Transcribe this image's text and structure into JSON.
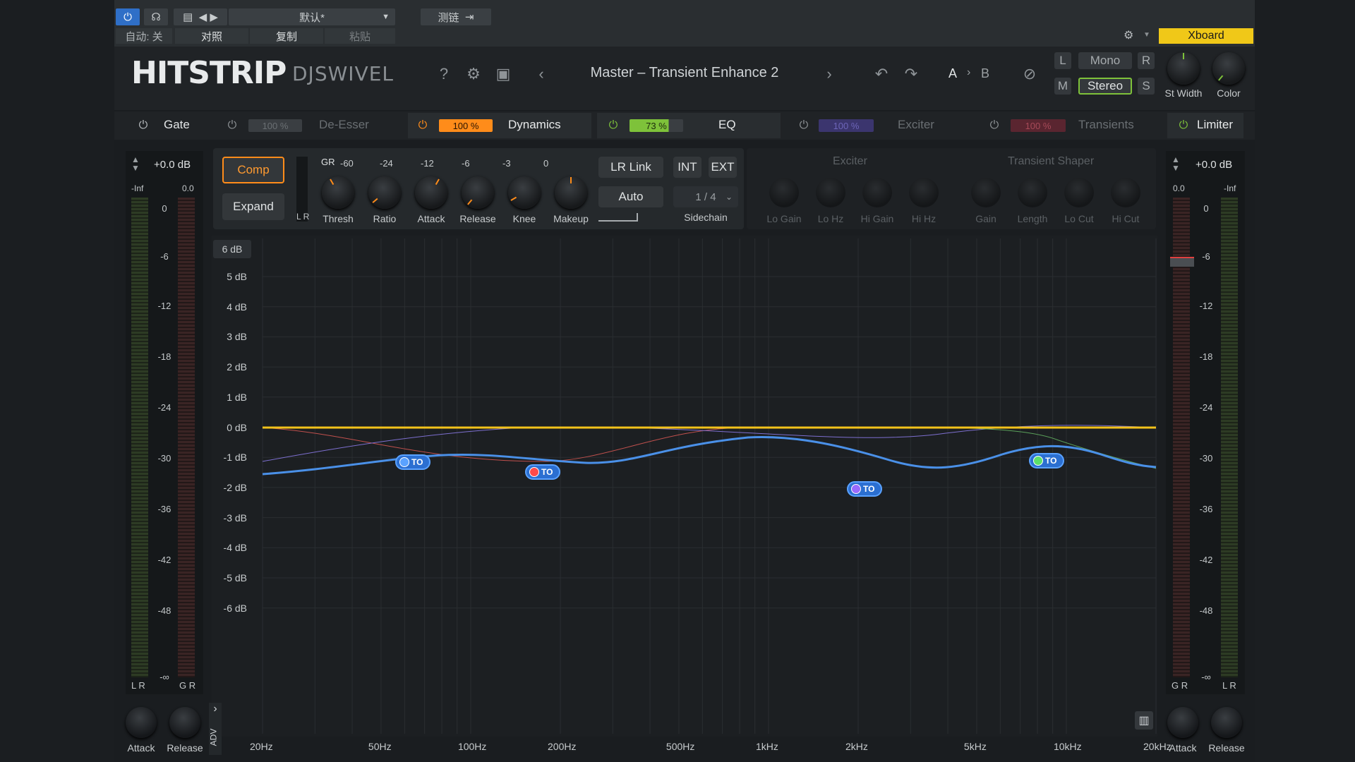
{
  "host": {
    "preset_name": "默认*",
    "auto_label": "自动: 关",
    "compare_label": "对照",
    "copy_label": "复制",
    "paste_label": "粘贴",
    "sidechain_label": "测链",
    "xboard_label": "Xboard"
  },
  "header": {
    "logo": "HITSTRIP",
    "brand": "DJSWIVEL",
    "preset_title": "Master – Transient Enhance 2",
    "ab_a": "A",
    "ab_b": "B",
    "l_label": "L",
    "r_label": "R",
    "m_label": "M",
    "s_label": "S",
    "mono_label": "Mono",
    "stereo_label": "Stereo",
    "stwidth_label": "St Width",
    "color_label": "Color"
  },
  "modules": [
    {
      "name": "Gate",
      "percent": "",
      "color": "#cfd3d6"
    },
    {
      "name": "De-Esser",
      "percent": "100 %",
      "color": "#6a6f73"
    },
    {
      "name": "Dynamics",
      "percent": "100 %",
      "color": "#ff8c1a"
    },
    {
      "name": "EQ",
      "percent": "73 %",
      "color": "#7ec23a"
    },
    {
      "name": "Exciter",
      "percent": "100 %",
      "color": "#5a4fb8"
    },
    {
      "name": "Transients",
      "percent": "100 %",
      "color": "#b83a4a"
    },
    {
      "name": "Limiter",
      "percent": "",
      "color": "#cfd3d6"
    }
  ],
  "input_meter": {
    "gain": "+0.0 dB",
    "min_label": "-Inf",
    "max_label": "0.0",
    "scale": [
      "0",
      "-6",
      "-12",
      "-18",
      "-24",
      "-30",
      "-36",
      "-42",
      "-48",
      "-∞"
    ],
    "lr_label": "L R",
    "gr_label": "G R"
  },
  "output_meter": {
    "gain": "+0.0 dB",
    "min_label": "0.0",
    "max_label": "-Inf",
    "scale": [
      "0",
      "-6",
      "-12",
      "-18",
      "-24",
      "-30",
      "-36",
      "-42",
      "-48",
      "-∞"
    ],
    "gr_label": "G R",
    "lr_label": "L R"
  },
  "dynamics": {
    "comp_label": "Comp",
    "expand_label": "Expand",
    "gr_label": "GR",
    "lr_label": "L R",
    "gr_scale": [
      "-60",
      "-24",
      "-12",
      "-6",
      "-3",
      "0"
    ],
    "knobs": [
      "Thresh",
      "Ratio",
      "Attack",
      "Release",
      "Knee",
      "Makeup"
    ],
    "lr_link_label": "LR Link",
    "auto_label": "Auto",
    "int_label": "INT",
    "ext_label": "EXT",
    "sidechain_value": "1 / 4",
    "sidechain_label": "Sidechain"
  },
  "exciter": {
    "title": "Exciter",
    "knobs": [
      "Lo Gain",
      "Lo Hz",
      "Hi Gain",
      "Hi Hz"
    ]
  },
  "transient_shaper": {
    "title": "Transient Shaper",
    "knobs": [
      "Gain",
      "Length",
      "Lo Cut",
      "Hi Cut"
    ]
  },
  "eq": {
    "range_label": "6 dB",
    "db_labels": [
      "5 dB",
      "4 dB",
      "3 dB",
      "2 dB",
      "1 dB",
      "0 dB",
      "-1 dB",
      "-2 dB",
      "-3 dB",
      "-4 dB",
      "-5 dB",
      "-6 dB"
    ],
    "hz_labels": [
      "20Hz",
      "50Hz",
      "100Hz",
      "200Hz",
      "500Hz",
      "1kHz",
      "2kHz",
      "5kHz",
      "10kHz",
      "20kHz"
    ],
    "nodes": [
      {
        "label": "TO",
        "color": "#5aa2ff"
      },
      {
        "label": "TO",
        "color": "#ff4a4a"
      },
      {
        "label": "TO",
        "color": "#9a6bff"
      },
      {
        "label": "TO",
        "color": "#5ce06b"
      }
    ]
  },
  "bottom": {
    "attack_label": "Attack",
    "release_label": "Release",
    "adv_label": "ADV"
  }
}
